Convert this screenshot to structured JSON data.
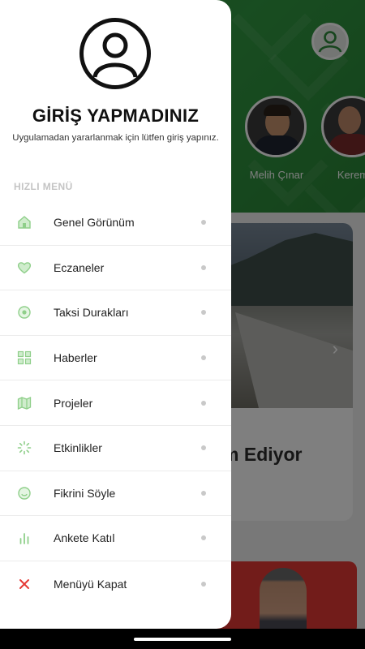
{
  "background": {
    "stories": [
      {
        "name": "Melih Çınar"
      },
      {
        "name": "Kerem"
      }
    ],
    "news_card": {
      "title_fragment": "um Ediyor"
    }
  },
  "drawer": {
    "title": "GİRİŞ YAPMADINIZ",
    "subtitle": "Uygulamadan yararlanmak için lütfen giriş yapınız.",
    "section_label": "HIZLI MENÜ",
    "items": [
      {
        "label": "Genel Görünüm",
        "icon": "home-icon"
      },
      {
        "label": "Eczaneler",
        "icon": "heart-icon"
      },
      {
        "label": "Taksi Durakları",
        "icon": "target-icon"
      },
      {
        "label": "Haberler",
        "icon": "grid-icon"
      },
      {
        "label": "Projeler",
        "icon": "map-icon"
      },
      {
        "label": "Etkinlikler",
        "icon": "loader-icon"
      },
      {
        "label": "Fikrini Söyle",
        "icon": "smile-icon"
      },
      {
        "label": "Ankete Katıl",
        "icon": "bar-chart-icon"
      },
      {
        "label": "Menüyü Kapat",
        "icon": "close-icon"
      }
    ]
  },
  "colors": {
    "accent_green": "#319a42",
    "icon_green": "#8fcf8a",
    "close_red": "#e53935",
    "news_red": "#e53935"
  }
}
